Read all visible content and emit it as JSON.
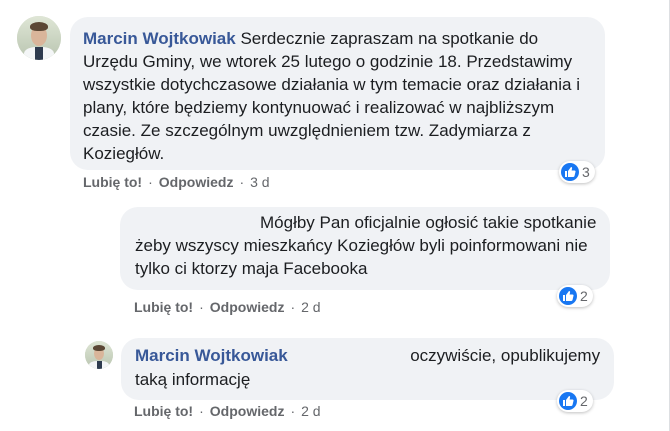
{
  "comments": [
    {
      "author": "Marcin Wojtkowiak",
      "text": "Serdecznie zapraszam na spotkanie do Urzędu Gminy, we wtorek 25 lutego o godzinie 18. Przedstawimy wszystkie dotychczasowe działania w tym temacie oraz działania i plany, które będziemy kontynuować i realizować w najbliższym czasie. Ze szczególnym uwzględnieniem tzw. Zadymiarza z Koziegłów.",
      "like_label": "Lubię to!",
      "reply_label": "Odpowiedz",
      "time": "3 d",
      "reaction_count": "3",
      "reaction_icon": "like-icon"
    },
    {
      "text": "Mógłby Pan oficjalnie ogłosić takie spotkanie żeby wszyscy mieszkańcy Koziegłów byli poinformowani nie tylko ci ktorzy maja Facebooka",
      "like_label": "Lubię to!",
      "reply_label": "Odpowiedz",
      "time": "2 d",
      "reaction_count": "2",
      "reaction_icon": "like-icon"
    },
    {
      "author": "Marcin Wojtkowiak",
      "text": "oczywiście, opublikujemy taką informację",
      "like_label": "Lubię to!",
      "reply_label": "Odpowiedz",
      "time": "2 d",
      "reaction_count": "2",
      "reaction_icon": "like-icon"
    }
  ],
  "separator": "·",
  "colors": {
    "author": "#385898",
    "bubble": "#f0f2f5",
    "meta": "#65676b",
    "like": "#1877f2"
  }
}
